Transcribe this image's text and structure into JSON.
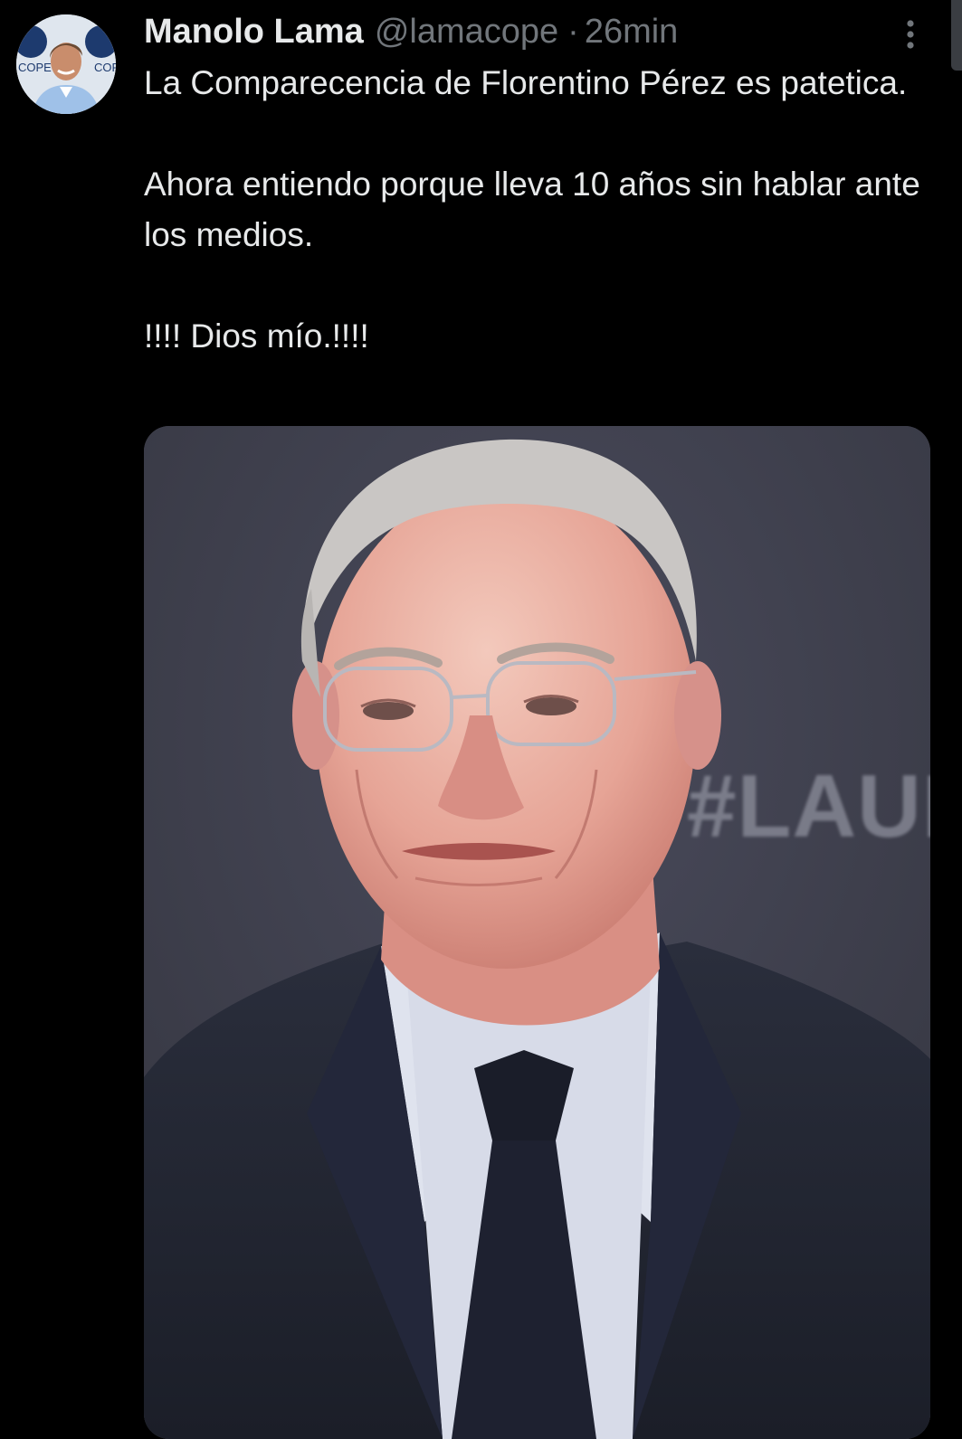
{
  "author": {
    "display_name": "Manolo Lama",
    "handle": "@lamacope",
    "separator": "·",
    "time": "26min",
    "avatar_logo_text": "COPE"
  },
  "tweet": {
    "paragraphs": [
      "La Comparecencia de Florentino Pérez es patetica.",
      "Ahora entiendo porque lleva 10 años sin hablar ante los medios.",
      "!!!! Dios mío.!!!!"
    ]
  },
  "media": {
    "backdrop_text": "#LAUR"
  },
  "icons": {
    "more": "more-vertical-icon"
  },
  "colors": {
    "background": "#000000",
    "primary_text": "#e7e9ea",
    "secondary_text": "#71767b",
    "photo_backdrop": "#3f4050"
  }
}
